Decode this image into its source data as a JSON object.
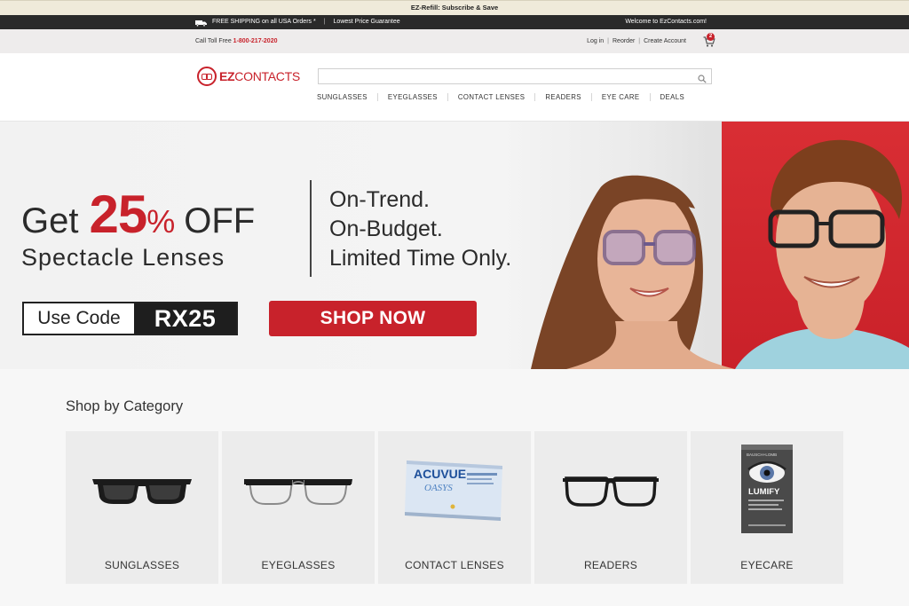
{
  "promo_bar": {
    "text": "EZ-Refill: Subscribe & Save"
  },
  "ship_bar": {
    "shipping_text": "FREE SHIPPING on all USA Orders *",
    "separator": "|",
    "guarantee_text": "Lowest Price Guarantee",
    "welcome_text": "Welcome to EzContacts.com!"
  },
  "util_bar": {
    "toll_label": "Call Toll Free",
    "toll_phone": "1-800-217-2020",
    "login": "Log in",
    "reorder": "Reorder",
    "create_account": "Create Account",
    "sep": "|",
    "cart_count": "2"
  },
  "header": {
    "logo_ez": "EZ",
    "logo_contacts": "CONTACTS",
    "search_placeholder": "",
    "nav": [
      "SUNGLASSES",
      "EYEGLASSES",
      "CONTACT LENSES",
      "READERS",
      "EYE CARE",
      "DEALS"
    ]
  },
  "hero": {
    "get": "Get",
    "percent": "25",
    "percent_sign": "%",
    "off": "OFF",
    "spectacle": "Spectacle Lenses",
    "tagline_1": "On-Trend.",
    "tagline_2": "On-Budget.",
    "tagline_3": "Limited Time Only.",
    "code_label": "Use Code",
    "code_value": "RX25",
    "cta": "SHOP NOW"
  },
  "category": {
    "title": "Shop by Category",
    "items": [
      {
        "label": "SUNGLASSES",
        "icon": "sunglasses-icon"
      },
      {
        "label": "EYEGLASSES",
        "icon": "eyeglasses-icon"
      },
      {
        "label": "CONTACT LENSES",
        "icon": "contact-lens-box-icon"
      },
      {
        "label": "READERS",
        "icon": "readers-icon"
      },
      {
        "label": "EYECARE",
        "icon": "eye-drops-box-icon"
      }
    ],
    "product_text": {
      "acuvue": "ACUVUE",
      "oasys": "OASYS",
      "lumify": "LUMIFY",
      "bausch": "BAUSCH+LOMB"
    }
  },
  "colors": {
    "brand_red": "#c8222b",
    "dark_bar": "#2a2a2a",
    "promo_bg": "#efeada"
  }
}
